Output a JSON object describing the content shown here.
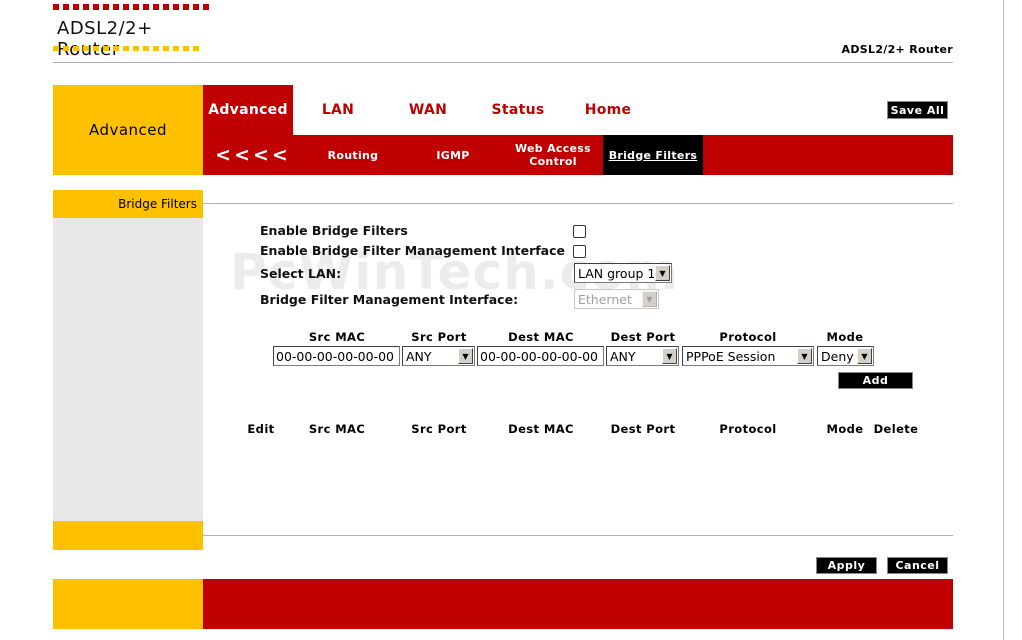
{
  "header": {
    "logo_text": "ADSL2/2+ Router",
    "brand_text": "ADSL2/2+ Router"
  },
  "nav": {
    "section_title": "Advanced",
    "tabs": [
      "Advanced",
      "LAN",
      "WAN",
      "Status",
      "Home"
    ],
    "active_tab": "Advanced",
    "save_all_label": "Save All",
    "sub": {
      "back_label": "<<<<",
      "items": [
        "Routing",
        "IGMP",
        "Web Access Control",
        "Bridge Filters"
      ],
      "web_access_line1": "Web Access",
      "web_access_line2": "Control",
      "active": "Bridge Filters"
    }
  },
  "sidebar": {
    "heading": "Bridge Filters"
  },
  "watermark": "PcWinTech.com",
  "form": {
    "enable_bridge_filters_label": "Enable Bridge Filters",
    "enable_bridge_filters_checked": false,
    "enable_mgmt_label": "Enable Bridge Filter Management Interface",
    "enable_mgmt_checked": false,
    "select_lan_label": "Select LAN:",
    "select_lan_value": "LAN group 1",
    "mgmt_interface_label": "Bridge Filter Management Interface:",
    "mgmt_interface_value": "Ethernet"
  },
  "rule_editor": {
    "headers": [
      "Src MAC",
      "Src Port",
      "Dest MAC",
      "Dest Port",
      "Protocol",
      "Mode"
    ],
    "src_mac": "00-00-00-00-00-00",
    "src_port": "ANY",
    "dest_mac": "00-00-00-00-00-00",
    "dest_port": "ANY",
    "protocol": "PPPoE Session",
    "mode": "Deny",
    "add_label": "Add"
  },
  "rules_table": {
    "headers": [
      "Edit",
      "Src MAC",
      "Src Port",
      "Dest MAC",
      "Dest Port",
      "Protocol",
      "Mode",
      "Delete"
    ],
    "rows": []
  },
  "actions": {
    "apply_label": "Apply",
    "cancel_label": "Cancel"
  },
  "colors": {
    "accent_red": "#c00000",
    "accent_yellow": "#ffc000"
  }
}
